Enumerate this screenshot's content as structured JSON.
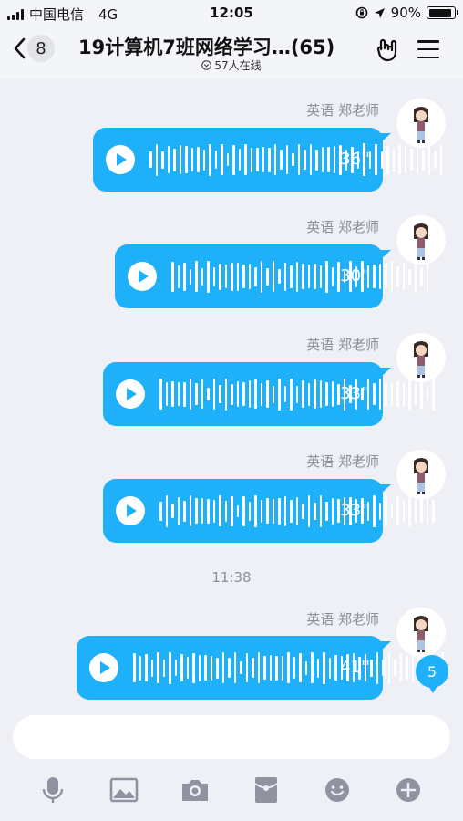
{
  "status": {
    "carrier": "中国电信",
    "network": "4G",
    "time": "12:05",
    "battery": "90%",
    "battery_level": 0.9
  },
  "header": {
    "back_count": "8",
    "title": "19计算机7班网络学习…(65)",
    "online": "57人在线"
  },
  "messages": [
    {
      "sender": "英语 郑老师",
      "duration": "36''"
    },
    {
      "sender": "英语 郑老师",
      "duration": "30''"
    },
    {
      "sender": "英语 郑老师",
      "duration": "33''"
    },
    {
      "sender": "英语 郑老师",
      "duration": "33''"
    },
    {
      "sender": "英语 郑老师",
      "duration": "41''"
    }
  ],
  "time_separator": "11:38",
  "new_message_count": "5",
  "toolbar": {
    "icons": [
      "microphone-icon",
      "image-icon",
      "camera-icon",
      "red-packet-icon",
      "emoji-icon",
      "plus-icon"
    ]
  },
  "colors": {
    "bubble": "#1eb0f8",
    "background": "#eef0f6"
  }
}
